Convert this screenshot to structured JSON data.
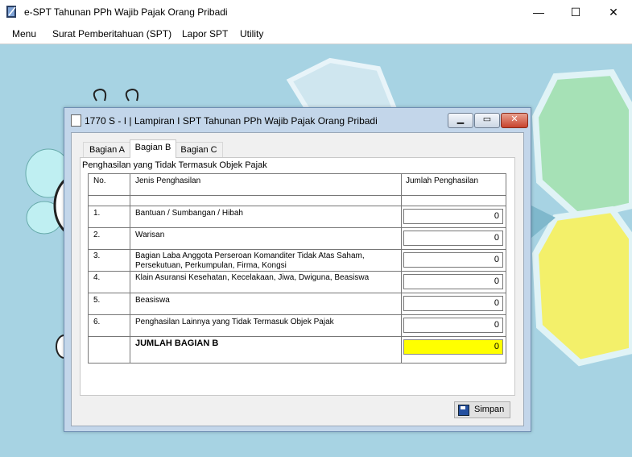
{
  "app": {
    "title": "e-SPT Tahunan PPh Wajib Pajak Orang Pribadi"
  },
  "window_controls": {
    "minimize": "—",
    "maximize": "☐",
    "close": "✕"
  },
  "menu": [
    "Menu",
    "Surat Pemberitahuan (SPT)",
    "Lapor SPT",
    "Utility"
  ],
  "dialog": {
    "title": "1770 S - I | Lampiran I SPT Tahunan PPh Wajib Pajak Orang Pribadi",
    "tabs": [
      "Bagian A",
      "Bagian B",
      "Bagian C"
    ],
    "active_tab": "Bagian B",
    "section_title": "Penghasilan yang Tidak Termasuk Objek Pajak",
    "headers": {
      "no": "No.",
      "jenis": "Jenis Penghasilan",
      "jumlah": "Jumlah Penghasilan"
    },
    "rows": [
      {
        "no": "1.",
        "jenis": "Bantuan / Sumbangan / Hibah",
        "value": "0"
      },
      {
        "no": "2.",
        "jenis": "Warisan",
        "value": "0"
      },
      {
        "no": "3.",
        "jenis": "Bagian Laba Anggota Perseroan Komanditer Tidak Atas Saham,",
        "jenis2": "Persekutuan, Perkumpulan, Firma, Kongsi",
        "value": "0"
      },
      {
        "no": "4.",
        "jenis": "Klain Asuransi Kesehatan, Kecelakaan, Jiwa, Dwiguna, Beasiswa",
        "value": "0"
      },
      {
        "no": "5.",
        "jenis": "Beasiswa",
        "value": "0"
      },
      {
        "no": "6.",
        "jenis": "Penghasilan Lainnya yang Tidak Termasuk Objek Pajak",
        "value": "0"
      }
    ],
    "total": {
      "label": "JUMLAH BAGIAN B",
      "value": "0"
    },
    "save_label": "Simpan",
    "highlight_color": "#ffff00"
  }
}
